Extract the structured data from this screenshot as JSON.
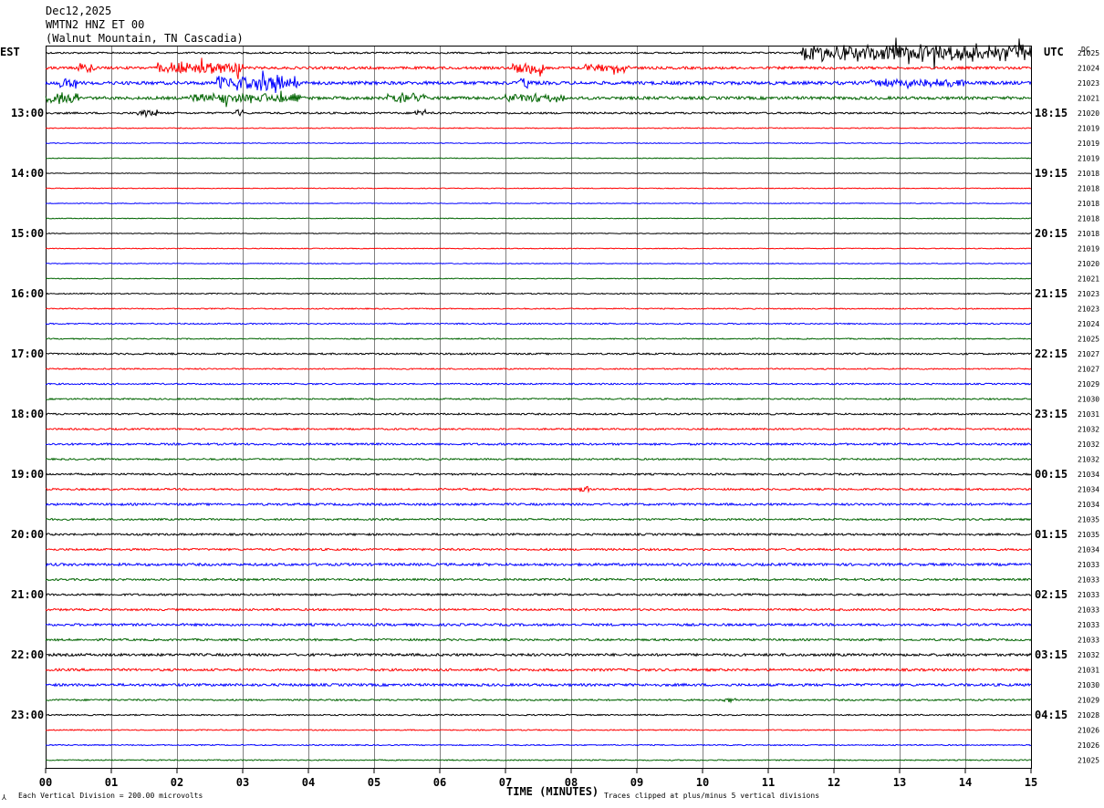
{
  "header": {
    "date": "Dec12,2025",
    "station": "WMTN2 HNZ ET 00",
    "location": "(Walnut Mountain, TN Cascadia)"
  },
  "labels": {
    "left_zone": "EST",
    "right_zone": "UTC",
    "dc_title": "DC"
  },
  "footer": {
    "scale_note": "Each Vertical Division =  200.00 microvolts",
    "xaxis_title": "TIME (MINUTES)",
    "clip_note": "Traces clipped at plus/minus 5 vertical divisions"
  },
  "chart_data": {
    "type": "line",
    "title": "",
    "xlabel": "TIME (MINUTES)",
    "xlim": [
      0,
      15
    ],
    "x_ticks": [
      "00",
      "01",
      "02",
      "03",
      "04",
      "05",
      "06",
      "07",
      "08",
      "09",
      "10",
      "11",
      "12",
      "13",
      "14",
      "15"
    ],
    "est_labels": [
      "13:00",
      "14:00",
      "15:00",
      "16:00",
      "17:00",
      "18:00",
      "19:00",
      "20:00",
      "21:00",
      "22:00",
      "23:00"
    ],
    "utc_labels": [
      "18:15",
      "19:15",
      "20:15",
      "21:15",
      "22:15",
      "23:15",
      "00:15",
      "01:15",
      "02:15",
      "03:15",
      "04:15"
    ],
    "hour_label_first_row": 4,
    "rows_per_hour": 4,
    "trace_colors": [
      "#000000",
      "#ff0000",
      "#0000ff",
      "#006400"
    ],
    "dc_values": [
      "21025",
      "21024",
      "21023",
      "21021",
      "21020",
      "21019",
      "21019",
      "21019",
      "21018",
      "21018",
      "21018",
      "21018",
      "21018",
      "21019",
      "21020",
      "21021",
      "21023",
      "21023",
      "21024",
      "21025",
      "21027",
      "21027",
      "21029",
      "21030",
      "21031",
      "21032",
      "21032",
      "21032",
      "21034",
      "21034",
      "21034",
      "21035",
      "21035",
      "21034",
      "21033",
      "21033",
      "21033",
      "21033",
      "21033",
      "21033",
      "21032",
      "21031",
      "21030",
      "21029",
      "21028",
      "21026",
      "21026",
      "21025"
    ],
    "trace_noise": [
      0.9,
      1.4,
      1.8,
      1.6,
      1.0,
      0.5,
      0.45,
      0.45,
      0.35,
      0.45,
      0.4,
      0.45,
      0.4,
      0.45,
      0.45,
      0.45,
      0.6,
      0.6,
      0.7,
      0.6,
      0.9,
      0.7,
      0.8,
      0.8,
      0.95,
      0.9,
      1.1,
      0.9,
      1.0,
      1.0,
      1.2,
      1.0,
      1.1,
      1.1,
      1.4,
      1.1,
      1.1,
      1.1,
      1.3,
      1.1,
      1.4,
      1.3,
      1.4,
      0.9,
      0.7,
      0.6,
      0.6,
      0.6
    ],
    "events": [
      {
        "row": 0,
        "start_min": 11.5,
        "end_min": 15.0,
        "amplitude": 9,
        "note": "large burst"
      },
      {
        "row": 1,
        "start_min": 0.5,
        "end_min": 0.8,
        "amplitude": 4
      },
      {
        "row": 1,
        "start_min": 1.7,
        "end_min": 3.0,
        "amplitude": 6
      },
      {
        "row": 1,
        "start_min": 7.1,
        "end_min": 7.6,
        "amplitude": 5
      },
      {
        "row": 1,
        "start_min": 8.2,
        "end_min": 8.9,
        "amplitude": 3
      },
      {
        "row": 2,
        "start_min": 0.2,
        "end_min": 0.5,
        "amplitude": 4
      },
      {
        "row": 2,
        "start_min": 2.6,
        "end_min": 3.9,
        "amplitude": 7
      },
      {
        "row": 2,
        "start_min": 7.2,
        "end_min": 7.4,
        "amplitude": 4
      },
      {
        "row": 2,
        "start_min": 12.5,
        "end_min": 14.0,
        "amplitude": 3
      },
      {
        "row": 3,
        "start_min": 0.0,
        "end_min": 0.5,
        "amplitude": 5
      },
      {
        "row": 3,
        "start_min": 2.2,
        "end_min": 3.9,
        "amplitude": 4
      },
      {
        "row": 3,
        "start_min": 5.2,
        "end_min": 5.8,
        "amplitude": 4
      },
      {
        "row": 3,
        "start_min": 7.0,
        "end_min": 7.9,
        "amplitude": 4
      },
      {
        "row": 4,
        "start_min": 1.4,
        "end_min": 1.7,
        "amplitude": 3
      },
      {
        "row": 4,
        "start_min": 2.9,
        "end_min": 3.0,
        "amplitude": 5
      },
      {
        "row": 4,
        "start_min": 5.6,
        "end_min": 5.8,
        "amplitude": 4
      },
      {
        "row": 29,
        "start_min": 8.1,
        "end_min": 8.3,
        "amplitude": 3
      },
      {
        "row": 43,
        "start_min": 10.3,
        "end_min": 10.5,
        "amplitude": 2
      }
    ]
  }
}
